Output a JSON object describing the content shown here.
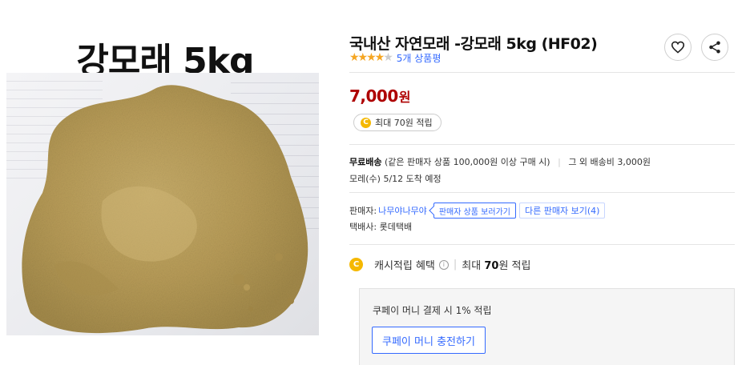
{
  "image": {
    "title": "강모래 5kg"
  },
  "product": {
    "title": "국내산 자연모래 -강모래 5kg (HF02)",
    "rating_stars": 4,
    "review_count": "5개 상품평"
  },
  "price": {
    "amount": "7,000",
    "unit": "원",
    "reward": "최대 70원 적립",
    "coin_glyph": "C"
  },
  "shipping": {
    "label": "무료배송",
    "condition": "(같은 판매자 상품 100,000원 이상 구매 시)",
    "other": "그 외 배송비 3,000원",
    "arrival": "모레(수) 5/12 도착 예정"
  },
  "seller": {
    "label": "판매자:",
    "name": "나무야나무야",
    "products_button": "판매자 상품 보러가기",
    "other_sellers_button": "다른 판매자 보기(4)",
    "courier_label": "택배사:",
    "courier": "롯데택배"
  },
  "cash": {
    "label": "캐시적립 혜택",
    "info_glyph": "i",
    "max_prefix": "최대",
    "max_amount": "70",
    "max_suffix": "원 적립"
  },
  "coupay": {
    "text": "쿠페이 머니 결제 시 1% 적립",
    "button": "쿠페이 머니 충전하기"
  },
  "colors": {
    "price_red": "#ae0000",
    "link_blue": "#346aff",
    "star": "#f5a623",
    "coin": "#f5b800"
  },
  "icons": [
    "heart-icon",
    "share-icon",
    "coin-icon",
    "info-icon",
    "star-icon"
  ]
}
